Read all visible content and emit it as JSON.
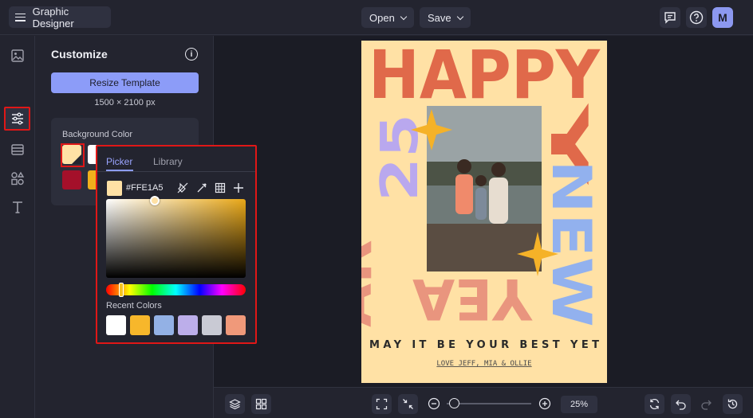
{
  "header": {
    "app_title": "Graphic Designer",
    "open_label": "Open",
    "save_label": "Save",
    "avatar_initial": "M",
    "icons": [
      "menu-icon",
      "chat-icon",
      "help-icon"
    ]
  },
  "sidebar": {
    "items": [
      {
        "name": "image-icon"
      },
      {
        "name": "sliders-icon",
        "selected": true
      },
      {
        "name": "layout-icon"
      },
      {
        "name": "shapes-icon"
      },
      {
        "name": "text-icon"
      }
    ]
  },
  "panel": {
    "title": "Customize",
    "resize_label": "Resize Template",
    "dimensions": "1500 × 2100 px",
    "background_label": "Background Color",
    "swatches": [
      "#ffe1a5",
      "#ffffff",
      "#a4102a",
      "#f0b01c"
    ]
  },
  "picker": {
    "tab_picker": "Picker",
    "tab_library": "Library",
    "hex": "#FFE1A5",
    "recent_label": "Recent Colors",
    "recent_colors": [
      "#ffffff",
      "#f7b72b",
      "#93b1e5",
      "#bcaeea",
      "#c9cad4",
      "#f0997a"
    ]
  },
  "card": {
    "word_happy": "HAPPY",
    "word_new": "NEW",
    "word_year": "YEAR",
    "number": "25",
    "tagline": "MAY IT BE YOUR BEST YET",
    "signature": "LOVE JEFF, MIA & OLLIE",
    "colors": {
      "orange": "#e0694a",
      "lilac": "#b9a8ee",
      "blue": "#92b1ee",
      "salmon": "#e9957e",
      "star": "#f5b228"
    }
  },
  "bottom": {
    "zoom": "25%"
  }
}
